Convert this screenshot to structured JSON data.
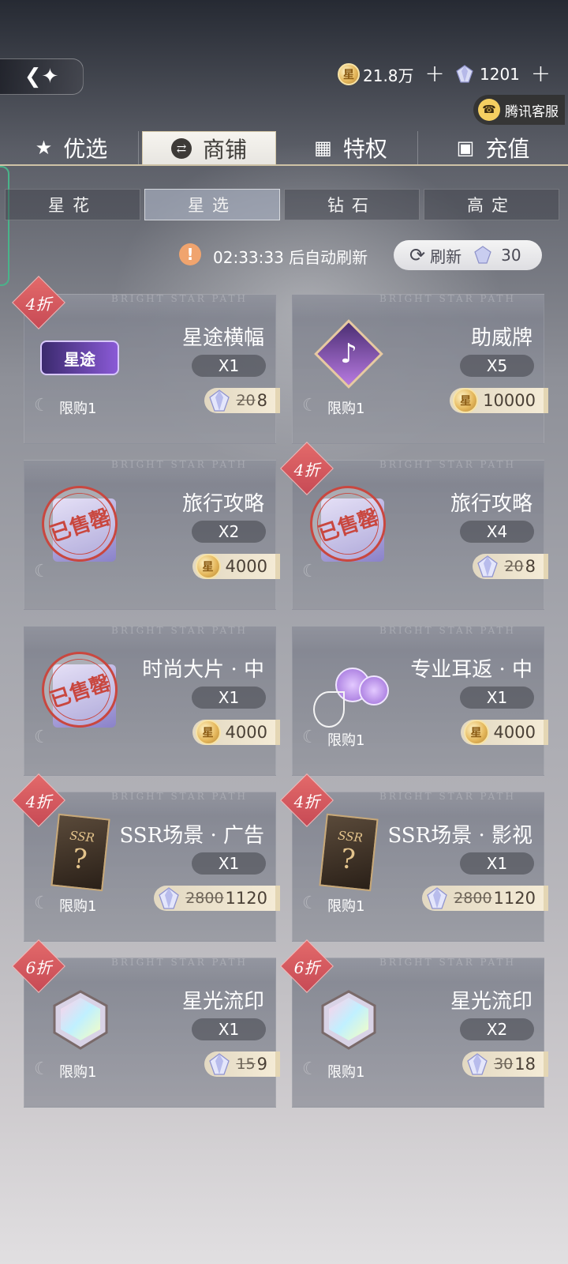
{
  "header": {
    "back_icon": "back-arrow-icon",
    "coins": "21.8万",
    "gems": "1201",
    "plus": "+",
    "service_label": "腾讯客服"
  },
  "main_tabs": [
    {
      "label": "优选",
      "icon": "star-icon"
    },
    {
      "label": "商铺",
      "icon": "swap-icon"
    },
    {
      "label": "特权",
      "icon": "card-icon"
    },
    {
      "label": "充值",
      "icon": "wallet-icon"
    }
  ],
  "sub_tabs": [
    "星花",
    "星选",
    "钻石",
    "高定"
  ],
  "refresh": {
    "timer_text": "02:33:33 后自动刷新",
    "button_label": "刷新",
    "cost": "30"
  },
  "watermark": "BRIGHT STAR PATH",
  "items": [
    {
      "name": "星途横幅",
      "qty": "X1",
      "limit": "限购1",
      "discount": "4折",
      "currency": "gem",
      "old_price": "20",
      "price": "8",
      "sold_out": false,
      "img_text": "星途"
    },
    {
      "name": "助威牌",
      "qty": "X5",
      "limit": "限购1",
      "discount": "",
      "currency": "coin",
      "old_price": "",
      "price": "10000",
      "sold_out": false,
      "img_text": "♪"
    },
    {
      "name": "旅行攻略",
      "qty": "X2",
      "limit": "",
      "discount": "",
      "currency": "coin",
      "old_price": "",
      "price": "4000",
      "sold_out": true,
      "img_text": ""
    },
    {
      "name": "旅行攻略",
      "qty": "X4",
      "limit": "",
      "discount": "4折",
      "currency": "gem",
      "old_price": "20",
      "price": "8",
      "sold_out": true,
      "img_text": ""
    },
    {
      "name": "时尚大片 · 中",
      "qty": "X1",
      "limit": "",
      "discount": "",
      "currency": "coin",
      "old_price": "",
      "price": "4000",
      "sold_out": true,
      "img_text": ""
    },
    {
      "name": "专业耳返 · 中",
      "qty": "X1",
      "limit": "限购1",
      "discount": "",
      "currency": "coin",
      "old_price": "",
      "price": "4000",
      "sold_out": false,
      "img_text": ""
    },
    {
      "name": "SSR场景 · 广告",
      "qty": "X1",
      "limit": "限购1",
      "discount": "4折",
      "currency": "gem",
      "old_price": "2800",
      "price": "1120",
      "sold_out": false,
      "img_text": "SSR"
    },
    {
      "name": "SSR场景 · 影视",
      "qty": "X1",
      "limit": "限购1",
      "discount": "4折",
      "currency": "gem",
      "old_price": "2800",
      "price": "1120",
      "sold_out": false,
      "img_text": "SSR"
    },
    {
      "name": "星光流印",
      "qty": "X1",
      "limit": "限购1",
      "discount": "6折",
      "currency": "gem",
      "old_price": "15",
      "price": "9",
      "sold_out": false,
      "img_text": ""
    },
    {
      "name": "星光流印",
      "qty": "X2",
      "limit": "限购1",
      "discount": "6折",
      "currency": "gem",
      "old_price": "30",
      "price": "18",
      "sold_out": false,
      "img_text": ""
    }
  ],
  "sold_out_label": "已售罄"
}
